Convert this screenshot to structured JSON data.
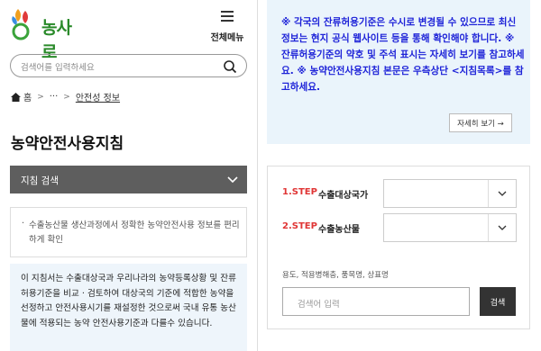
{
  "header": {
    "logo_text": "농사로",
    "menu_label": "전체메뉴",
    "menu_icon": "hamburger-icon"
  },
  "search": {
    "placeholder": "검색어를 입력하세요",
    "icon": "search-icon"
  },
  "breadcrumb": {
    "home": "홈",
    "ellipsis": "···",
    "current": "안전성 정보"
  },
  "page_title": "농약안전사용지침",
  "filter_bar": {
    "label": "지침 검색",
    "icon": "chevron-down-icon"
  },
  "note": {
    "bullet": "·",
    "text": "수출농산물 생산과정에서 정확한 농약안전사용 정보를 편리하게 확인"
  },
  "description": "이 지침서는 수출대상국과 우리나라의 농약등록상황 및 잔류허용기준을 비교 · 검토하여 대상국의 기준에 적합한 농약을 선정하고 안전사용시기를 재설정한 것으로써 국내 유통 농산물에 적용되는 농약 안전사용기준과 다를수 있습니다.",
  "info_box": {
    "text": "※ 각국의 잔류허용기준은 수시로 변경될 수 있으므로 최신 정보는 현지 공식 웹사이트 등을 통해 확인해야 합니다. ※ 잔류허용기준의 약호 및 주석 표시는 자세히 보기를 참고하세요. ※ 농약안전사용지침 본문은 우측상단 <지침목록>를 참고하세요.",
    "more_button": "자세히 보기 →",
    "text_color": "#1d22d8"
  },
  "form": {
    "step1": {
      "step": "1.STEP",
      "label": "수출대상국가",
      "value": ""
    },
    "step2": {
      "step": "2.STEP",
      "label": "수출농산물",
      "value": ""
    },
    "conditions_label": "용도, 적용병해충, 품목명, 상표명",
    "keyword_placeholder": "검색어 입력",
    "search_button": "검색",
    "step_color": "#e03535"
  }
}
